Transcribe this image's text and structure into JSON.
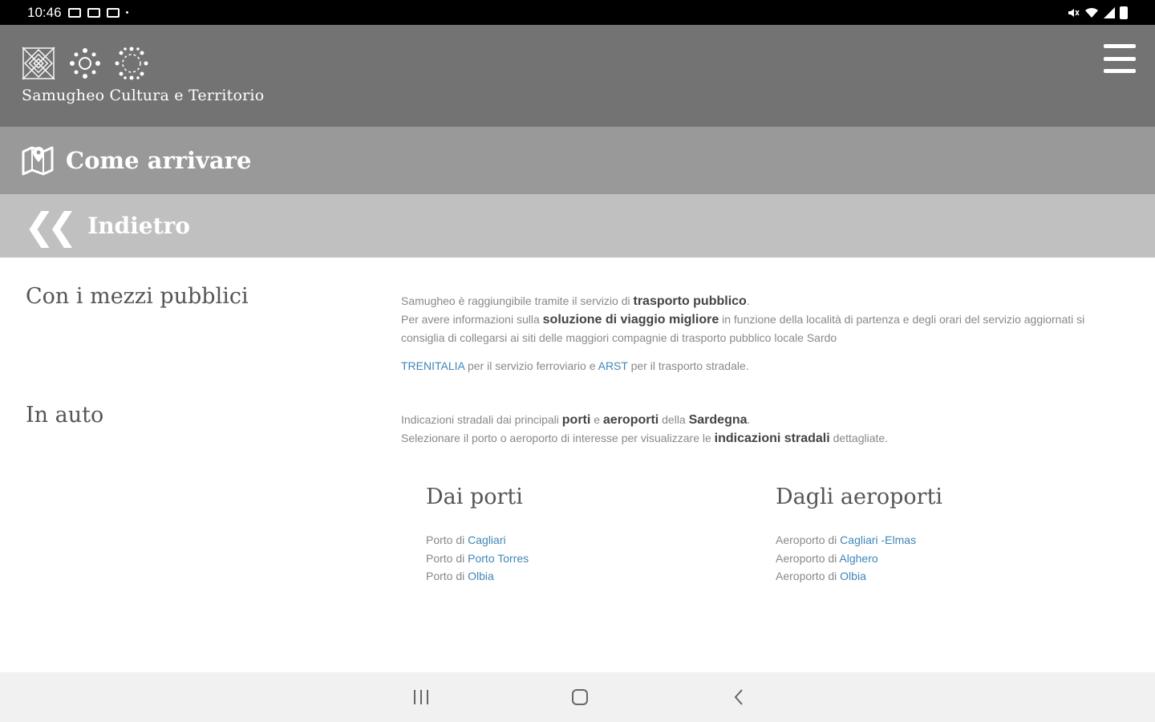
{
  "status_bar": {
    "time": "10:46"
  },
  "header": {
    "brand": "Samugheo Cultura e Territorio"
  },
  "title_bar": {
    "title": "Come arrivare"
  },
  "back": {
    "label": "Indietro"
  },
  "section_public": {
    "heading": "Con i mezzi pubblici",
    "line1_a": "Samugheo è raggiungibile tramite il servizio di ",
    "line1_b": "trasporto pubblico",
    "line1_c": ".",
    "line2_a": "Per avere informazioni sulla ",
    "line2_b": "soluzione di viaggio migliore",
    "line2_c": " in funzione della località di partenza e degli orari del servizio aggiornati si consiglia di collegarsi ai siti delle maggiori compagnie di trasporto pubblico locale Sardo",
    "link_trenitalia": "TRENITALIA",
    "line3_b": " per il servizio ferroviario e ",
    "link_arst": "ARST",
    "line3_d": " per il trasporto stradale."
  },
  "section_car": {
    "heading": "In auto",
    "line1_a": "Indicazioni stradali dai principali ",
    "line1_b": "porti",
    "line1_c": " e ",
    "line1_d": "aeroporti",
    "line1_e": " della ",
    "line1_f": "Sardegna",
    "line1_g": ".",
    "line2_a": "Selezionare il porto o aeroporto di interesse per visualizzare le ",
    "line2_b": "indicazioni stradali",
    "line2_c": " dettagliate."
  },
  "ports": {
    "heading": "Dai porti",
    "prefix": "Porto di ",
    "items": [
      "Cagliari",
      "Porto Torres",
      "Olbia"
    ]
  },
  "airports": {
    "heading": "Dagli aeroporti",
    "prefix": "Aeroporto di ",
    "items": [
      "Cagliari -Elmas",
      "Alghero",
      "Olbia"
    ]
  },
  "colors": {
    "header": "#737373",
    "title_bar": "#999999",
    "back_bar": "#c0c0c0",
    "link": "#3e86b8"
  },
  "icons": [
    "menu-icon",
    "map-pin-icon",
    "double-chevron-left-icon",
    "recents-icon",
    "home-icon",
    "back-icon"
  ]
}
